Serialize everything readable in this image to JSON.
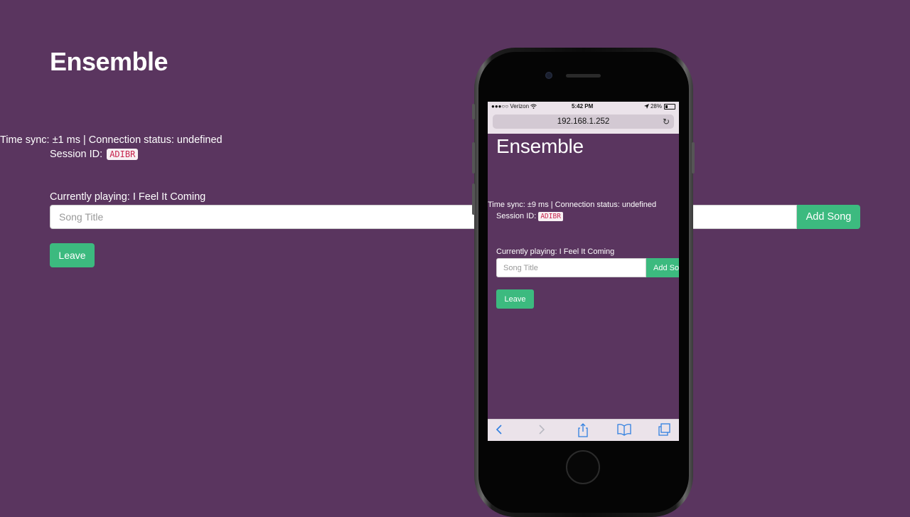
{
  "desktop": {
    "title": "Ensemble",
    "time_sync": "Time sync: ±1 ms | Connection status: undefined",
    "session_label": "Session ID:",
    "session_id": "ADIBR",
    "currently_playing": "Currently playing: I Feel It Coming",
    "song_input_placeholder": "Song Title",
    "add_song_label": "Add Song",
    "leave_label": "Leave"
  },
  "phone": {
    "status_bar": {
      "carrier": "●●●○○ Verizon",
      "time": "5:42 PM",
      "battery": "28%"
    },
    "url": "192.168.1.252",
    "app": {
      "title": "Ensemble",
      "time_sync": "Time sync: ±9 ms | Connection status: undefined",
      "session_label": "Session ID:",
      "session_id": "ADIBR",
      "currently_playing": "Currently playing: I Feel It Coming",
      "song_input_placeholder": "Song Title",
      "add_song_label": "Add Song",
      "leave_label": "Leave"
    }
  },
  "colors": {
    "background": "#5a355f",
    "button": "#3cba7f",
    "code_text": "#c7254e",
    "safari_link": "#2f7fe0"
  },
  "icons": [
    "wifi-icon",
    "location-icon",
    "battery-icon",
    "reload-icon",
    "back-icon",
    "forward-icon",
    "share-icon",
    "bookmarks-icon",
    "tabs-icon"
  ]
}
